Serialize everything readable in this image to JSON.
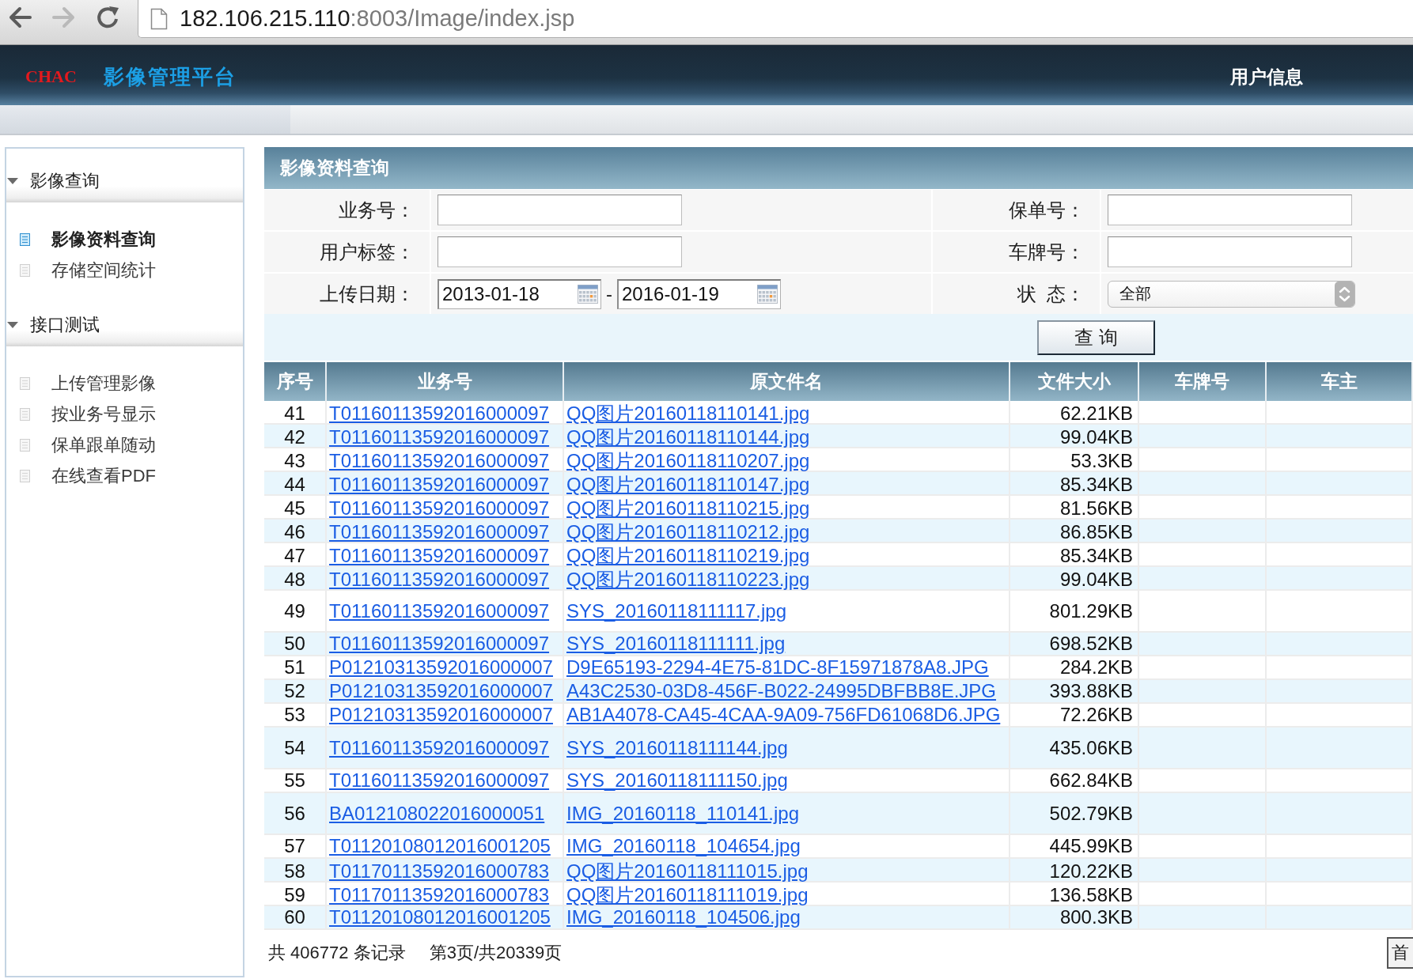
{
  "browser": {
    "nav_buttons": [
      {
        "kind": "back",
        "disabled": false
      },
      {
        "kind": "forward",
        "disabled": true
      },
      {
        "kind": "reload",
        "disabled": false
      }
    ],
    "address": {
      "host": "182.106.215.110",
      "path": ":8003/Image/index.jsp"
    }
  },
  "header": {
    "logo": "CHAC",
    "title": "影像管理平台",
    "user_link": "用户信息"
  },
  "sidebar": {
    "sections": [
      {
        "title": "影像查询",
        "expanded": true,
        "items": [
          {
            "label": "影像资料查询",
            "selected": true
          },
          {
            "label": "存储空间统计",
            "selected": false
          }
        ]
      },
      {
        "title": "接口测试",
        "expanded": true,
        "items": [
          {
            "label": "上传管理影像",
            "selected": false
          },
          {
            "label": "按业务号显示",
            "selected": false
          },
          {
            "label": "保单跟单随动",
            "selected": false
          },
          {
            "label": "在线查看PDF",
            "selected": false
          }
        ]
      }
    ]
  },
  "search_panel": {
    "title": "影像资料查询",
    "rows": [
      [
        {
          "kind": "text",
          "label": "业务号："
        },
        {
          "kind": "text",
          "label": "保单号："
        }
      ],
      [
        {
          "kind": "text",
          "label": "用户标签："
        },
        {
          "kind": "text",
          "label": "车牌号："
        }
      ],
      [
        {
          "kind": "date_range",
          "label": "上传日期：",
          "from": "2013-01-18",
          "separator": "-",
          "to": "2016-01-19"
        },
        {
          "kind": "select",
          "label": "状  态：",
          "value": "全部"
        }
      ]
    ],
    "submit": "查 询"
  },
  "table": {
    "columns": [
      "序号",
      "业务号",
      "原文件名",
      "文件大小",
      "车牌号",
      "车主"
    ],
    "rows": [
      {
        "kind": "normal",
        "no": "41",
        "business_no": "T01160113592016000097",
        "file_name": "QQ图片20160118110141.jpg",
        "file_size": "62.21KB"
      },
      {
        "kind": "normal",
        "no": "42",
        "business_no": "T01160113592016000097",
        "file_name": "QQ图片20160118110144.jpg",
        "file_size": "99.04KB"
      },
      {
        "kind": "normal",
        "no": "43",
        "business_no": "T01160113592016000097",
        "file_name": "QQ图片20160118110207.jpg",
        "file_size": "53.3KB"
      },
      {
        "kind": "normal",
        "no": "44",
        "business_no": "T01160113592016000097",
        "file_name": "QQ图片20160118110147.jpg",
        "file_size": "85.34KB"
      },
      {
        "kind": "normal",
        "no": "45",
        "business_no": "T01160113592016000097",
        "file_name": "QQ图片20160118110215.jpg",
        "file_size": "81.56KB"
      },
      {
        "kind": "normal",
        "no": "46",
        "business_no": "T01160113592016000097",
        "file_name": "QQ图片20160118110212.jpg",
        "file_size": "86.85KB"
      },
      {
        "kind": "normal",
        "no": "47",
        "business_no": "T01160113592016000097",
        "file_name": "QQ图片20160118110219.jpg",
        "file_size": "85.34KB"
      },
      {
        "kind": "normal",
        "no": "48",
        "business_no": "T01160113592016000097",
        "file_name": "QQ图片20160118110223.jpg",
        "file_size": "99.04KB"
      },
      {
        "kind": "tall",
        "no": "49",
        "business_no": "T01160113592016000097",
        "file_name": "SYS_20160118111117.jpg",
        "file_size": "801.29KB"
      },
      {
        "kind": "normal",
        "no": "50",
        "business_no": "T01160113592016000097",
        "file_name": "SYS_20160118111111.jpg",
        "file_size": "698.52KB"
      },
      {
        "kind": "normal",
        "no": "51",
        "business_no": "P01210313592016000007",
        "file_name": "D9E65193-2294-4E75-81DC-8F15971878A8.JPG",
        "file_size": "284.2KB"
      },
      {
        "kind": "normal",
        "no": "52",
        "business_no": "P01210313592016000007",
        "file_name": "A43C2530-03D8-456F-B022-24995DBFBB8E.JPG",
        "file_size": "393.88KB"
      },
      {
        "kind": "normal",
        "no": "53",
        "business_no": "P01210313592016000007",
        "file_name": "AB1A4078-CA45-4CAA-9A09-756FD61068D6.JPG",
        "file_size": "72.26KB"
      },
      {
        "kind": "tall",
        "no": "54",
        "business_no": "T01160113592016000097",
        "file_name": "SYS_20160118111144.jpg",
        "file_size": "435.06KB"
      },
      {
        "kind": "normal",
        "no": "55",
        "business_no": "T01160113592016000097",
        "file_name": "SYS_20160118111150.jpg",
        "file_size": "662.84KB"
      },
      {
        "kind": "tall",
        "no": "56",
        "business_no": "BA012108022016000051",
        "file_name": "IMG_20160118_110141.jpg",
        "file_size": "502.79KB"
      },
      {
        "kind": "normal",
        "no": "57",
        "business_no": "T01120108012016001205",
        "file_name": "IMG_20160118_104654.jpg",
        "file_size": "445.99KB"
      },
      {
        "kind": "normal",
        "no": "58",
        "business_no": "T01170113592016000783",
        "file_name": "QQ图片20160118111015.jpg",
        "file_size": "120.22KB"
      },
      {
        "kind": "normal",
        "no": "59",
        "business_no": "T01170113592016000783",
        "file_name": "QQ图片20160118111019.jpg",
        "file_size": "136.58KB"
      },
      {
        "kind": "normal",
        "no": "60",
        "business_no": "T01120108012016001205",
        "file_name": "IMG_20160118_104506.jpg",
        "file_size": "800.3KB"
      }
    ]
  },
  "footer": {
    "record_count": "共 406772 条记录",
    "page_info": "第3页/共20339页",
    "page_button": "首"
  }
}
